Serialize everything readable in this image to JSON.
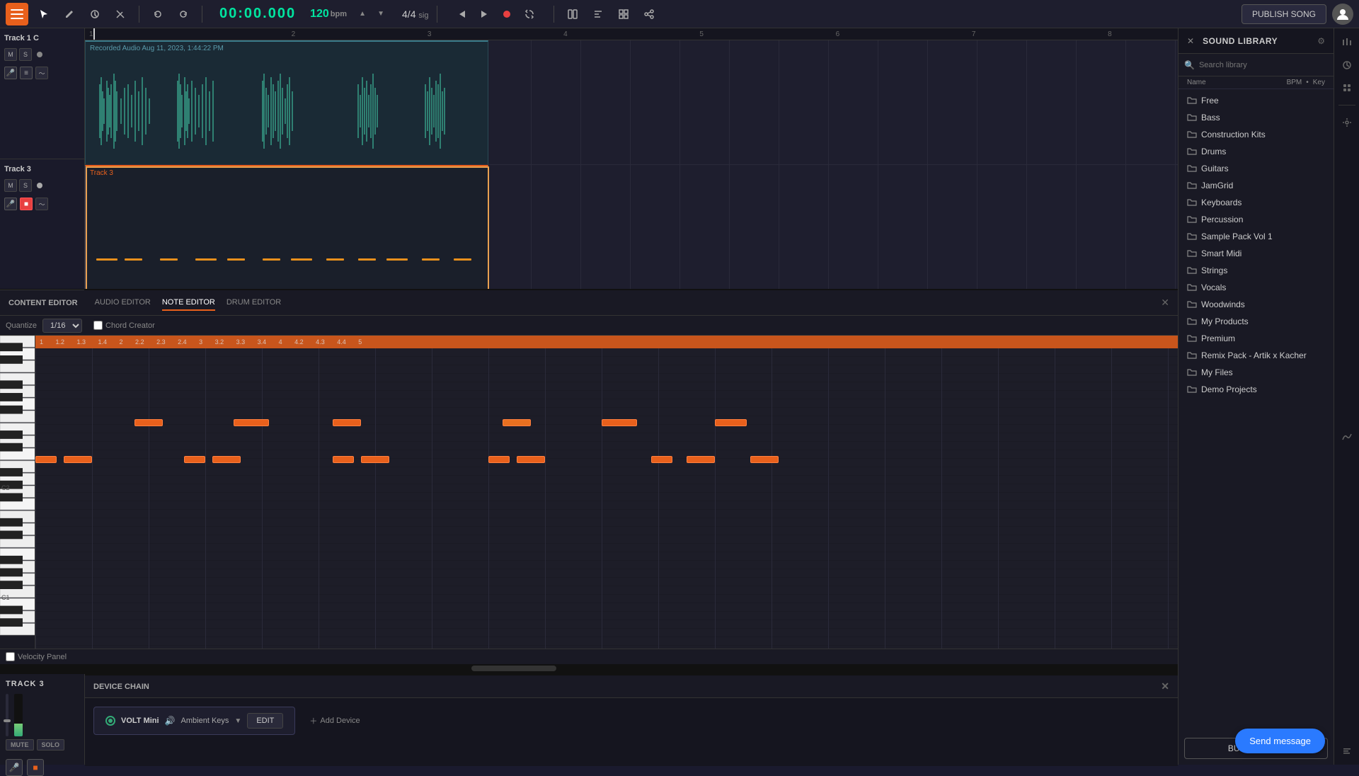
{
  "topbar": {
    "time": "00:00.000",
    "bpm": "120",
    "bpm_label": "bpm",
    "time_sig": "4/4",
    "time_sig_label": "sig",
    "publish_label": "PUBLISH SONG"
  },
  "tracks": {
    "track1": {
      "name": "Track 1 C",
      "clip_label": "Recorded Audio Aug 11, 2023, 1:44:22 PM"
    },
    "track3": {
      "name": "Track 3",
      "name_upper": "TRACK 3",
      "clip_label": "Track 3"
    }
  },
  "content_editor": {
    "section_title": "CONTENT EDITOR",
    "tabs": [
      "AUDIO EDITOR",
      "NOTE EDITOR",
      "DRUM EDITOR"
    ],
    "active_tab": "NOTE EDITOR"
  },
  "editor": {
    "quantize_label": "Quantize",
    "quantize_value": "1/16",
    "chord_creator_label": "Chord Creator",
    "velocity_panel_label": "Velocity Panel"
  },
  "device_chain": {
    "title": "DEVICE CHAIN",
    "device_name": "VOLT Mini",
    "device_preset": "Ambient Keys",
    "edit_label": "EDIT",
    "add_device_label": "Add Device"
  },
  "sound_library": {
    "title": "SOUND LIBRARY",
    "search_placeholder": "Search library",
    "columns": {
      "name": "Name",
      "bpm": "BPM",
      "key": "Key"
    },
    "items": [
      {
        "name": "Free",
        "type": "folder"
      },
      {
        "name": "Bass",
        "type": "folder"
      },
      {
        "name": "Construction Kits",
        "type": "folder"
      },
      {
        "name": "Drums",
        "type": "folder"
      },
      {
        "name": "Guitars",
        "type": "folder"
      },
      {
        "name": "JamGrid",
        "type": "folder"
      },
      {
        "name": "Keyboards",
        "type": "folder"
      },
      {
        "name": "Percussion",
        "type": "folder"
      },
      {
        "name": "Sample Pack Vol 1",
        "type": "folder"
      },
      {
        "name": "Smart Midi",
        "type": "folder"
      },
      {
        "name": "Strings",
        "type": "folder"
      },
      {
        "name": "Vocals",
        "type": "folder"
      },
      {
        "name": "Woodwinds",
        "type": "folder"
      },
      {
        "name": "My Products",
        "type": "folder"
      },
      {
        "name": "Premium",
        "type": "folder"
      },
      {
        "name": "Remix Pack - Artik x Kacher",
        "type": "folder"
      },
      {
        "name": "My Files",
        "type": "folder"
      },
      {
        "name": "Demo Projects",
        "type": "folder"
      }
    ],
    "buy_sounds_label": "BUY SOUNDS"
  },
  "bottom_track": {
    "name": "TRACK 3",
    "mute_label": "MUTE",
    "solo_label": "SOLO"
  },
  "send_message": {
    "label": "Send message"
  }
}
